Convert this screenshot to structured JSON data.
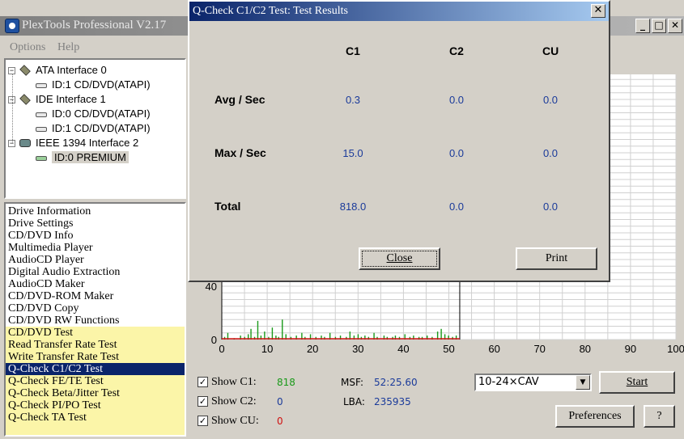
{
  "main_window": {
    "title": "PlexTools Professional V2.17",
    "menu": [
      "Options",
      "Help"
    ]
  },
  "tree": {
    "nodes": [
      {
        "label": "ATA Interface 0",
        "type": "interface",
        "expander": "−"
      },
      {
        "label": "ID:1  CD/DVD(ATAPI)",
        "type": "drive"
      },
      {
        "label": "IDE Interface 1",
        "type": "interface",
        "expander": "−"
      },
      {
        "label": "ID:0  CD/DVD(ATAPI)",
        "type": "drive"
      },
      {
        "label": "ID:1  CD/DVD(ATAPI)",
        "type": "drive"
      },
      {
        "label": "IEEE 1394 Interface 2",
        "type": "interface-1394",
        "expander": "−"
      },
      {
        "label": "ID:0  PREMIUM",
        "type": "drive",
        "selected": true
      }
    ]
  },
  "functions": {
    "items": [
      {
        "label": "Drive Information"
      },
      {
        "label": "Drive Settings"
      },
      {
        "label": "CD/DVD Info"
      },
      {
        "label": "Multimedia Player"
      },
      {
        "label": "AudioCD Player"
      },
      {
        "label": "Digital Audio Extraction"
      },
      {
        "label": "AudioCD Maker"
      },
      {
        "label": "CD/DVD-ROM Maker"
      },
      {
        "label": "CD/DVD Copy"
      },
      {
        "label": "CD/DVD RW Functions"
      },
      {
        "label": "CD/DVD Test",
        "highlight": true
      },
      {
        "label": "Read Transfer Rate Test",
        "highlight": true
      },
      {
        "label": "Write Transfer Rate Test",
        "highlight": true
      },
      {
        "label": "Q-Check C1/C2 Test",
        "active": true
      },
      {
        "label": "Q-Check FE/TE Test",
        "highlight": true
      },
      {
        "label": "Q-Check Beta/Jitter Test",
        "highlight": true
      },
      {
        "label": "Q-Check PI/PO Test",
        "highlight": true
      },
      {
        "label": "Q-Check TA Test",
        "highlight": true
      }
    ]
  },
  "chart_data": {
    "type": "bar",
    "x_ticks": [
      "0",
      "10",
      "20",
      "30",
      "40",
      "50",
      "60",
      "70",
      "80",
      "90",
      "100"
    ],
    "y_ticks": [
      "40",
      "0"
    ],
    "xlim": [
      0,
      100
    ],
    "ylim": [
      0,
      40
    ],
    "grid": true,
    "data_end_x": 52.4,
    "series": [
      {
        "color": "#1a9a1a",
        "values": [
          [
            0.5,
            2
          ],
          [
            1.2,
            5
          ],
          [
            2.6,
            1
          ],
          [
            4.0,
            3
          ],
          [
            4.9,
            2
          ],
          [
            5.7,
            4
          ],
          [
            6.3,
            8
          ],
          [
            7.1,
            2
          ],
          [
            7.8,
            14
          ],
          [
            8.5,
            3
          ],
          [
            9.3,
            6
          ],
          [
            10.2,
            2
          ],
          [
            11.0,
            9
          ],
          [
            11.8,
            3
          ],
          [
            12.4,
            2
          ],
          [
            13.2,
            15
          ],
          [
            14.0,
            4
          ],
          [
            15.1,
            2
          ],
          [
            16.3,
            3
          ],
          [
            17.5,
            5
          ],
          [
            18.2,
            2
          ],
          [
            19.4,
            4
          ],
          [
            20.6,
            2
          ],
          [
            21.8,
            3
          ],
          [
            22.5,
            2
          ],
          [
            23.7,
            5
          ],
          [
            24.9,
            2
          ],
          [
            26.0,
            3
          ],
          [
            27.3,
            2
          ],
          [
            28.1,
            6
          ],
          [
            29.0,
            3
          ],
          [
            29.9,
            4
          ],
          [
            30.6,
            2
          ],
          [
            31.4,
            3
          ],
          [
            32.2,
            2
          ],
          [
            33.4,
            5
          ],
          [
            34.1,
            2
          ],
          [
            35.6,
            3
          ],
          [
            36.3,
            2
          ],
          [
            37.5,
            2
          ],
          [
            38.1,
            3
          ],
          [
            39.0,
            2
          ],
          [
            40.2,
            4
          ],
          [
            41.3,
            2
          ],
          [
            42.1,
            3
          ],
          [
            43.3,
            2
          ],
          [
            44.0,
            2
          ],
          [
            45.1,
            3
          ],
          [
            46.2,
            2
          ],
          [
            47.4,
            6
          ],
          [
            48.2,
            8
          ],
          [
            49.0,
            4
          ],
          [
            49.8,
            3
          ],
          [
            50.7,
            2
          ],
          [
            51.5,
            3
          ]
        ]
      },
      {
        "color": "#d01010",
        "values": [
          [
            0,
            0.6
          ],
          [
            52.4,
            0.6
          ]
        ]
      }
    ]
  },
  "controls": {
    "show_c1": {
      "label": "Show C1:",
      "value": "818",
      "color": "#1a9a1a",
      "checked": true
    },
    "show_c2": {
      "label": "Show C2:",
      "value": "0",
      "color": "#1a3a9a",
      "checked": true
    },
    "show_cu": {
      "label": "Show CU:",
      "value": "0",
      "color": "#d01010",
      "checked": true
    },
    "msf_label": "MSF:",
    "msf_value": "52:25.60",
    "lba_label": "LBA:",
    "lba_value": "235935",
    "speed_selected": "10-24×CAV",
    "start_label": "Start",
    "preferences_label": "Preferences",
    "help_label": "?"
  },
  "dialog": {
    "title": "Q-Check C1/C2 Test: Test Results",
    "close_x": "✕",
    "columns": [
      "C1",
      "C2",
      "CU"
    ],
    "rows": [
      {
        "label": "Avg / Sec",
        "values": [
          "0.3",
          "0.0",
          "0.0"
        ]
      },
      {
        "label": "Max / Sec",
        "values": [
          "15.0",
          "0.0",
          "0.0"
        ]
      },
      {
        "label": "Total",
        "values": [
          "818.0",
          "0.0",
          "0.0"
        ]
      }
    ],
    "close_label": "Close",
    "print_label": "Print"
  }
}
